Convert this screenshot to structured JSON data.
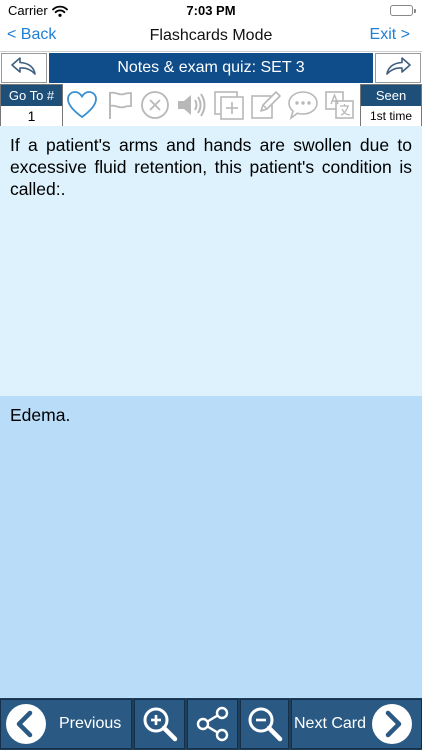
{
  "status": {
    "carrier": "Carrier",
    "time": "7:03 PM"
  },
  "nav": {
    "back_label": "< Back",
    "title": "Flashcards Mode",
    "exit_label": "Exit >"
  },
  "set": {
    "title": "Notes & exam quiz: SET 3"
  },
  "goto": {
    "label": "Go To #",
    "value": "1"
  },
  "seen": {
    "label": "Seen",
    "value": "1st time"
  },
  "card": {
    "question": "If a patient's arms and hands are swollen due to excessive fluid retention, this patient's condition is called:.",
    "answer": "Edema."
  },
  "bottom": {
    "previous_label": "Previous",
    "next_label": "Next Card"
  },
  "icons": {
    "toolbar": [
      "heart-icon",
      "flag-icon",
      "close-circle-icon",
      "speaker-icon",
      "add-card-icon",
      "edit-icon",
      "comment-icon",
      "translate-icon"
    ],
    "bottom": [
      "chevron-left-icon",
      "zoom-in-icon",
      "share-icon",
      "zoom-out-icon",
      "chevron-right-icon"
    ]
  },
  "colors": {
    "accent": "#1e7fd4",
    "set_bar": "#0f4c8a",
    "label_bg": "#1d4f79",
    "question_bg": "#ddf2fd",
    "answer_bg": "#b9dcf8",
    "bottom_bar": "#2a5a83",
    "icon_blue": "#3a8fd0",
    "icon_gray": "#b8b8b8"
  }
}
